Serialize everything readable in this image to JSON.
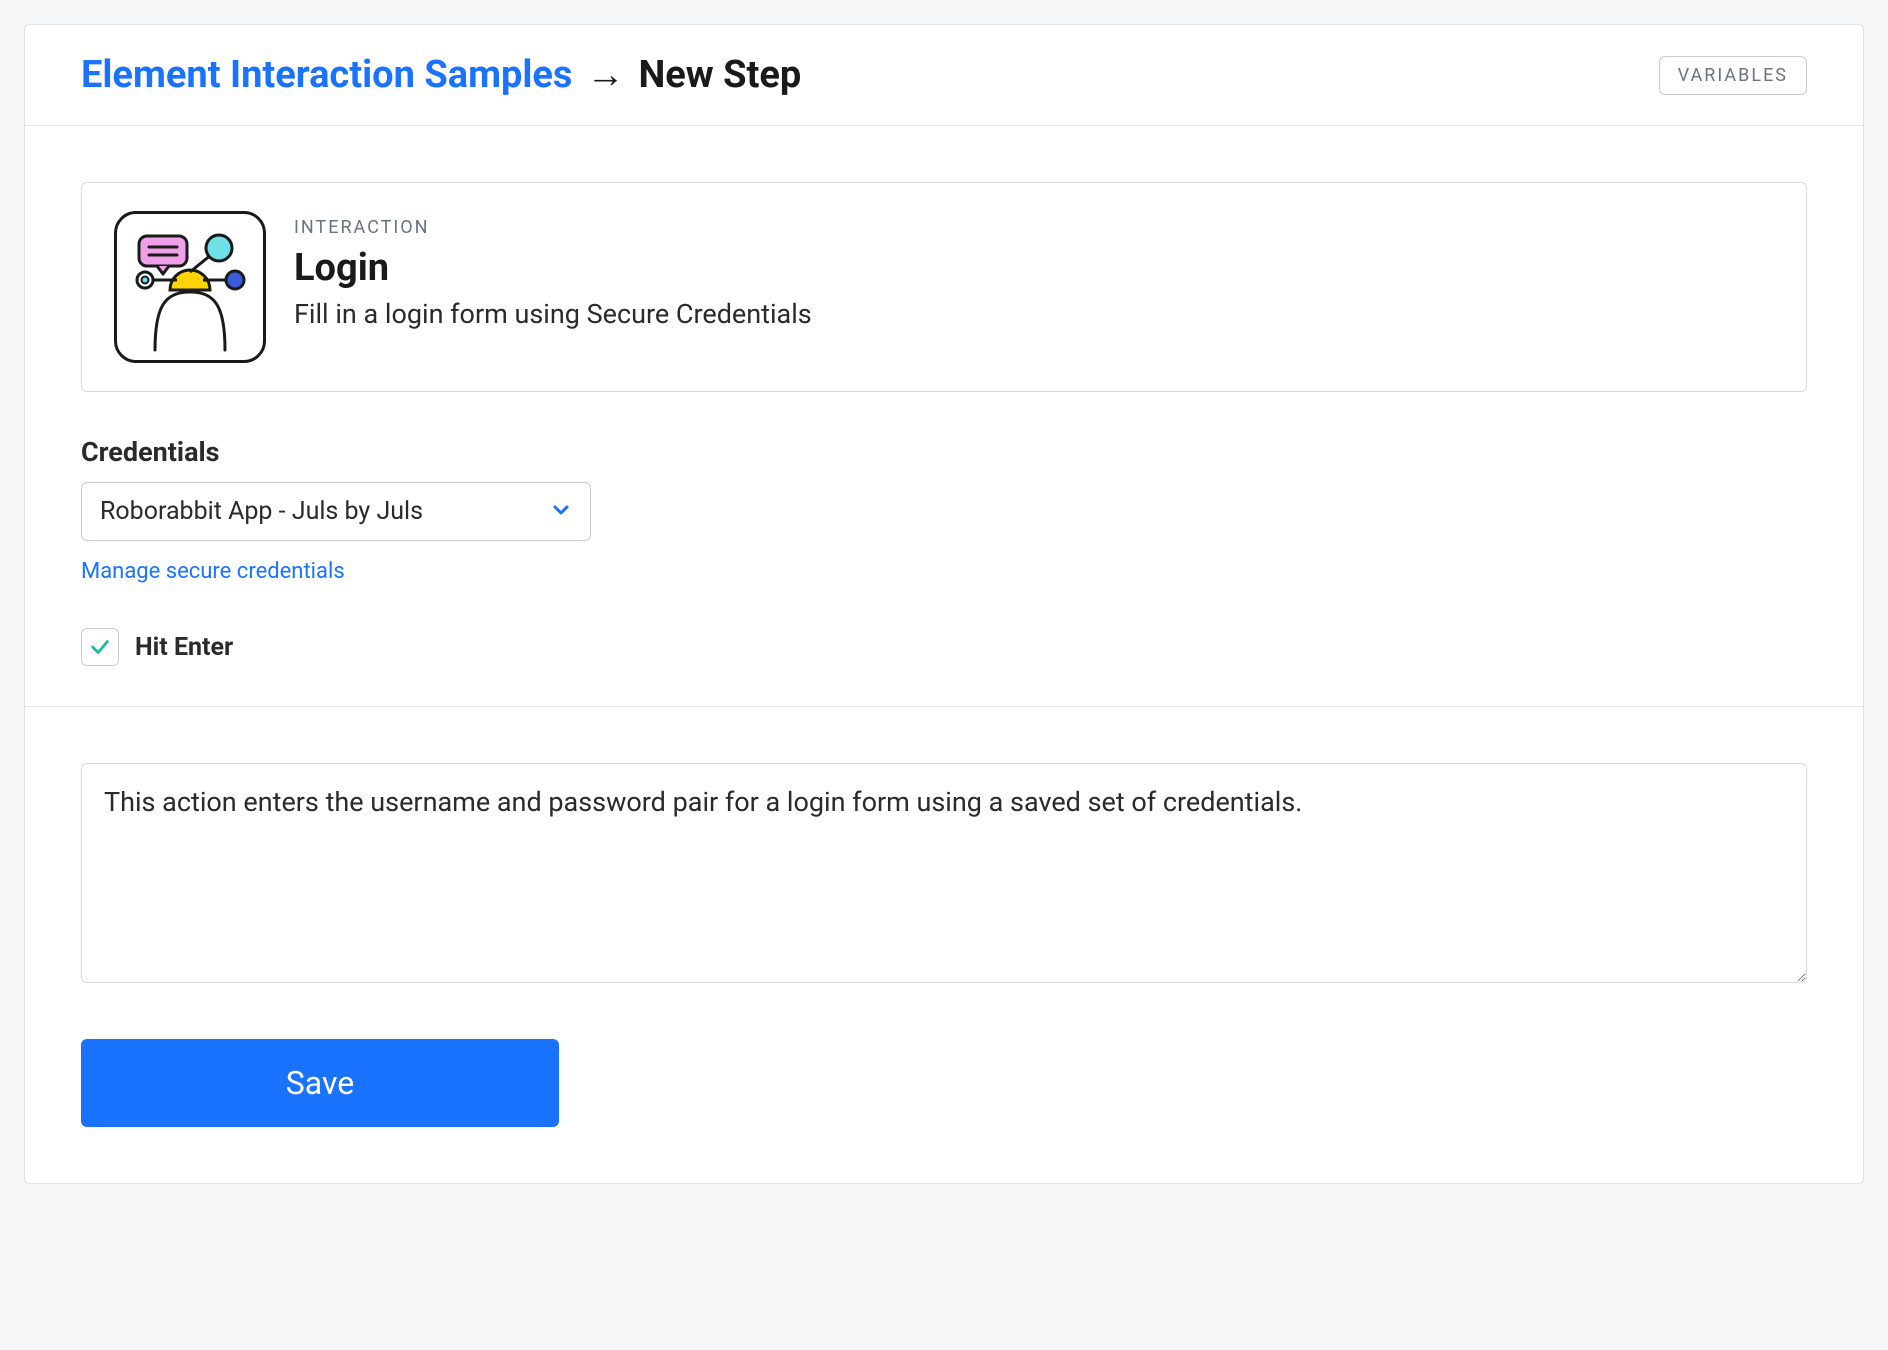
{
  "header": {
    "breadcrumb_link": "Element Interaction Samples",
    "breadcrumb_arrow": "→",
    "breadcrumb_current": "New Step",
    "variables_button": "VARIABLES"
  },
  "interaction": {
    "label": "INTERACTION",
    "title": "Login",
    "description": "Fill in a login form using Secure Credentials"
  },
  "credentials": {
    "label": "Credentials",
    "selected": "Roborabbit App - Juls by Juls",
    "manage_link": "Manage secure credentials"
  },
  "hit_enter": {
    "label": "Hit Enter",
    "checked": true
  },
  "description_text": "This action enters the username and password pair for a login form using a saved set of credentials.",
  "save_button": "Save"
}
